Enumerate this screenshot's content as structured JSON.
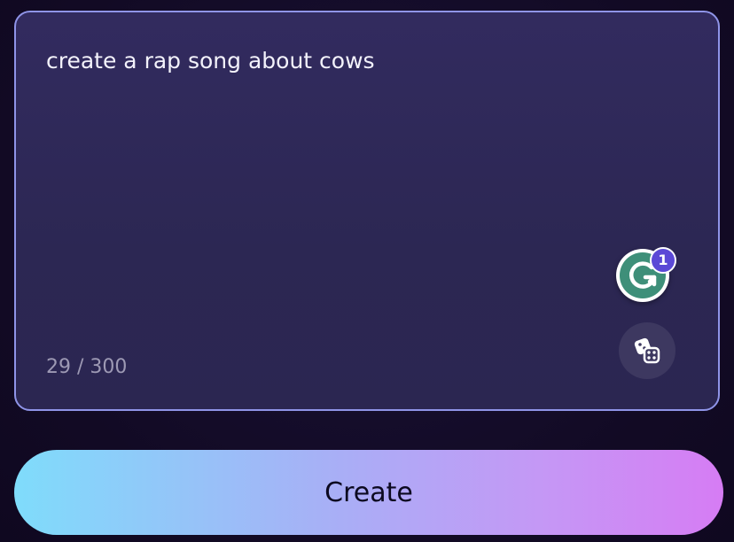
{
  "prompt": {
    "text": "create a rap song about cows",
    "char_count": "29 / 300"
  },
  "grammarly": {
    "icon": "grammarly-icon",
    "badge_count": "1",
    "color": "#3e8f79"
  },
  "random_button": {
    "icon": "dice-icon"
  },
  "create_button": {
    "label": "Create",
    "gradient": [
      "#7fdcfb",
      "#a8aff6",
      "#c597f5",
      "#d67cf4"
    ]
  },
  "colors": {
    "background": "#120b26",
    "box_fill": "#2d2856",
    "box_border": "#8f94e8",
    "badge": "#5b49d6"
  }
}
